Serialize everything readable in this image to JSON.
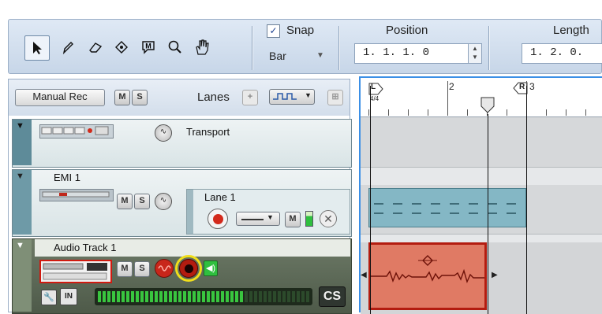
{
  "toolbar": {
    "tools": [
      {
        "name": "select-tool",
        "glyph": "➤",
        "selected": true
      },
      {
        "name": "pencil-tool",
        "glyph": "✎"
      },
      {
        "name": "eraser-tool",
        "glyph": "⌫"
      },
      {
        "name": "paint-tool",
        "glyph": "◈"
      },
      {
        "name": "mute-tool",
        "glyph": "Ⓜ"
      },
      {
        "name": "magnify-tool",
        "glyph": "🔍"
      },
      {
        "name": "hand-tool",
        "glyph": "✋"
      }
    ],
    "snap_label": "Snap",
    "snap_checked": true,
    "snap_value": "Bar",
    "position_label": "Position",
    "position_value": "1. 1. 1.   0",
    "length_label": "Length",
    "length_value": "1. 2. 0."
  },
  "track_header": {
    "manual_rec": "Manual Rec",
    "mute": "M",
    "solo": "S",
    "lanes_label": "Lanes"
  },
  "tracks": {
    "transport": {
      "name": "Transport"
    },
    "emi": {
      "name": "EMI 1",
      "lane_name": "Lane 1",
      "mute": "M",
      "solo": "S",
      "lane_mute": "M"
    },
    "audio": {
      "name": "Audio Track 1",
      "mute": "M",
      "solo": "S",
      "cs_label": "CS",
      "accent": "#cc2b1d"
    }
  },
  "ruler": {
    "left_locator": "L",
    "time_sig": "4/4",
    "bar2": "2",
    "right_locator": "R",
    "bar3": "3"
  },
  "colors": {
    "selection_blue": "#3b8fe6",
    "note_clip": "#84b7c5",
    "audio_clip": "#e07a64",
    "clip_border_red": "#b31c10",
    "highlight_yellow": "#f0de1a"
  }
}
